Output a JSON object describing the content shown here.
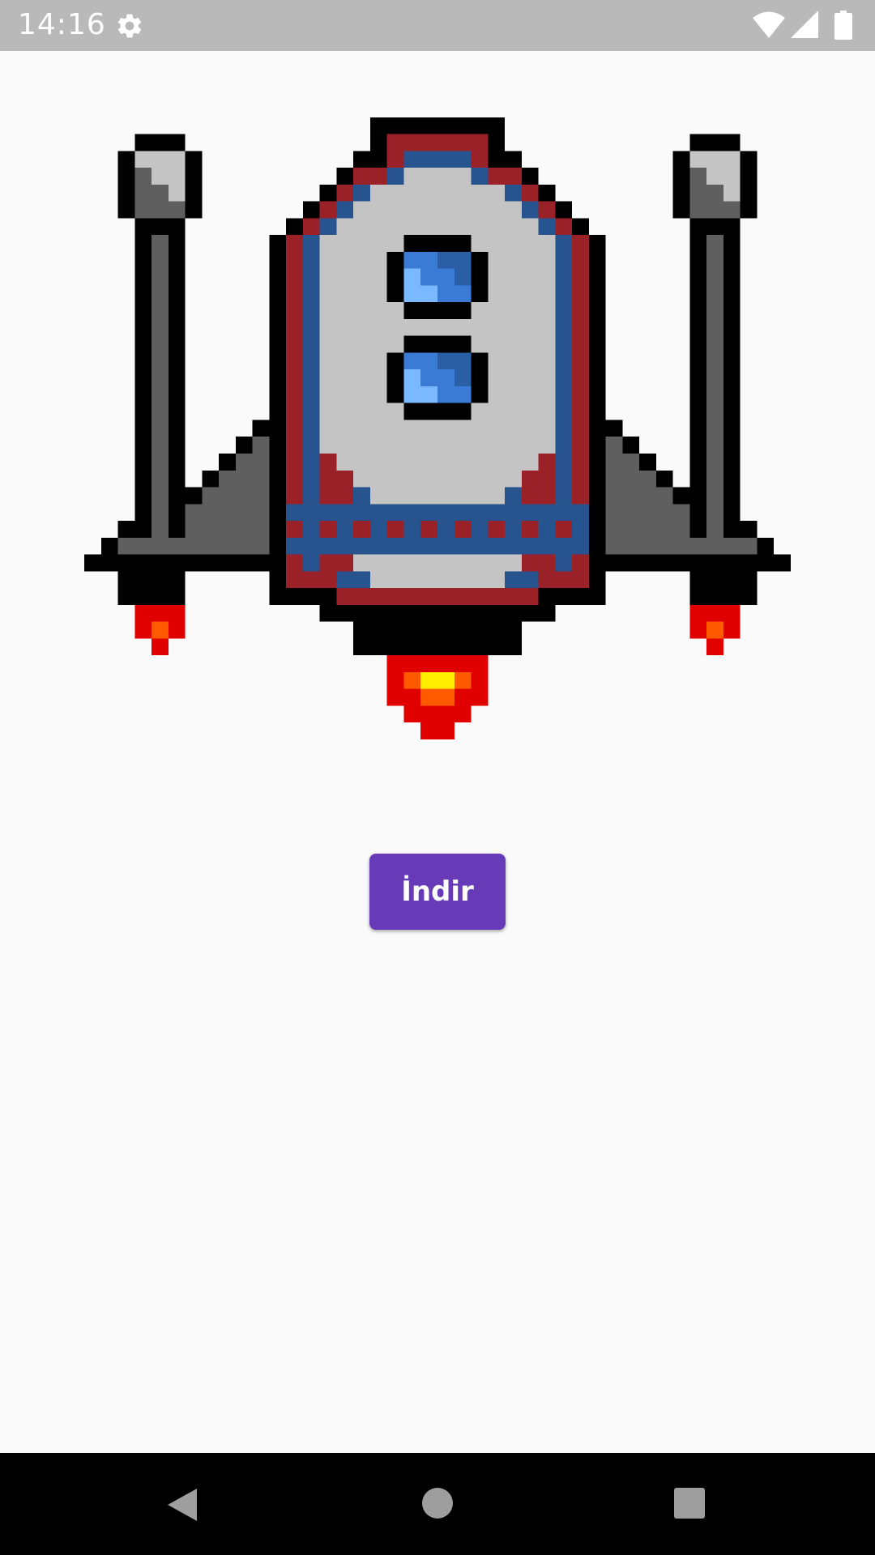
{
  "status_bar": {
    "time": "14:16",
    "icons": [
      "settings-icon",
      "wifi-icon",
      "cellular-signal-icon",
      "battery-icon"
    ]
  },
  "main": {
    "image": "rocket-ship-illustration",
    "download_button_label": "İndir"
  },
  "nav_bar": {
    "icons": [
      "back-icon",
      "home-icon",
      "recents-icon"
    ]
  },
  "colors": {
    "accent": "#673ab7",
    "status_bar": "#b9b9b9",
    "background": "#fafafa",
    "nav_bar": "#000000"
  }
}
